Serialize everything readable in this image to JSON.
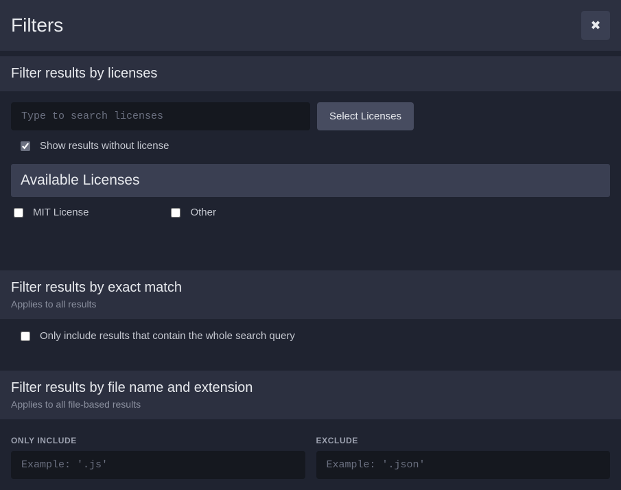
{
  "header": {
    "title": "Filters"
  },
  "licenses_section": {
    "title": "Filter results by licenses",
    "search_placeholder": "Type to search licenses",
    "select_button": "Select Licenses",
    "show_without_label": "Show results without license",
    "available_title": "Available Licenses",
    "items": [
      {
        "label": "MIT License"
      },
      {
        "label": "Other"
      }
    ]
  },
  "exact_match_section": {
    "title": "Filter results by exact match",
    "subtitle": "Applies to all results",
    "only_whole_label": "Only include results that contain the whole search query"
  },
  "filename_section": {
    "title": "Filter results by file name and extension",
    "subtitle": "Applies to all file-based results",
    "include_label": "ONLY INCLUDE",
    "include_placeholder": "Example: '.js'",
    "exclude_label": "EXCLUDE",
    "exclude_placeholder": "Example: '.json'"
  }
}
